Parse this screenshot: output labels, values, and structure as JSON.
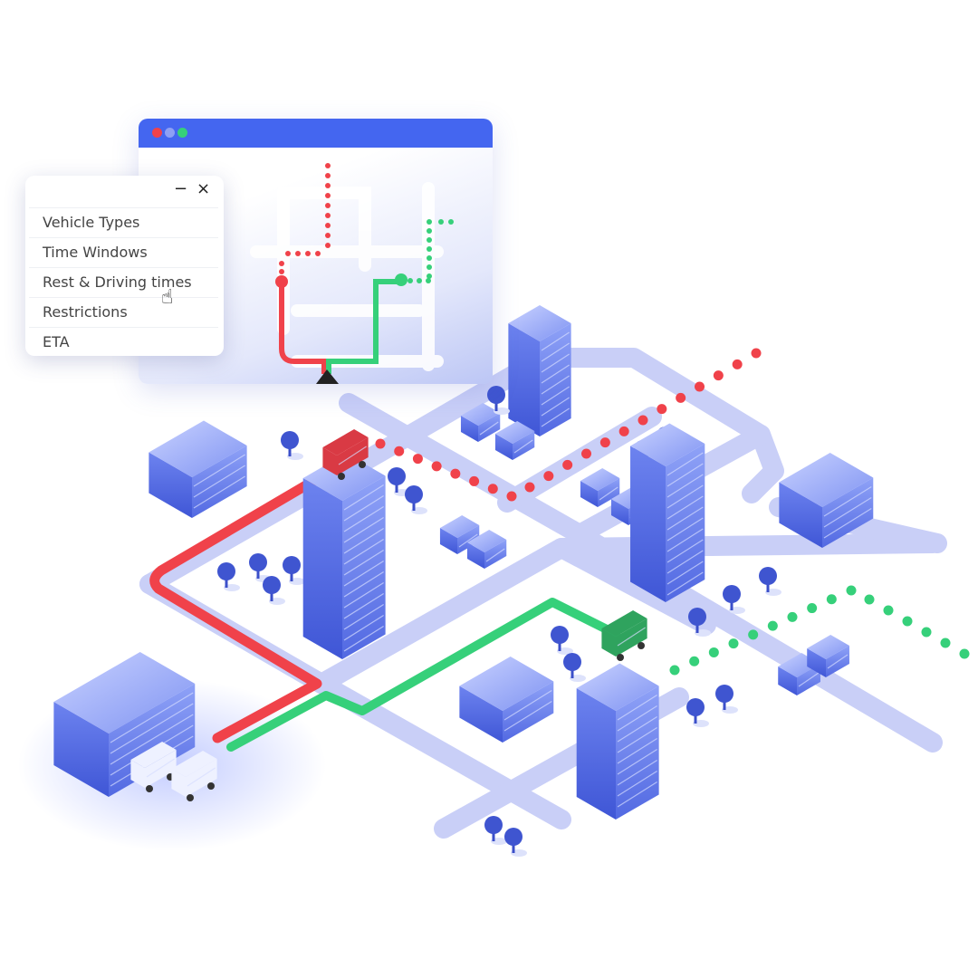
{
  "colors": {
    "accent": "#4466f0",
    "road": "#c9cff7",
    "route_red": "#f0424a",
    "route_green": "#36d07a",
    "building": "#5a73e8"
  },
  "app_window": {
    "dots": [
      "#f0424a",
      "#8ea0f5",
      "#36d07a"
    ]
  },
  "menu": {
    "minimize_label": "−",
    "close_label": "×",
    "items": [
      {
        "label": "Vehicle Types"
      },
      {
        "label": "Time Windows"
      },
      {
        "label": "Rest & Driving times"
      },
      {
        "label": "Restrictions"
      },
      {
        "label": "ETA"
      }
    ],
    "cursor_icon": "hand-pointer-icon"
  }
}
